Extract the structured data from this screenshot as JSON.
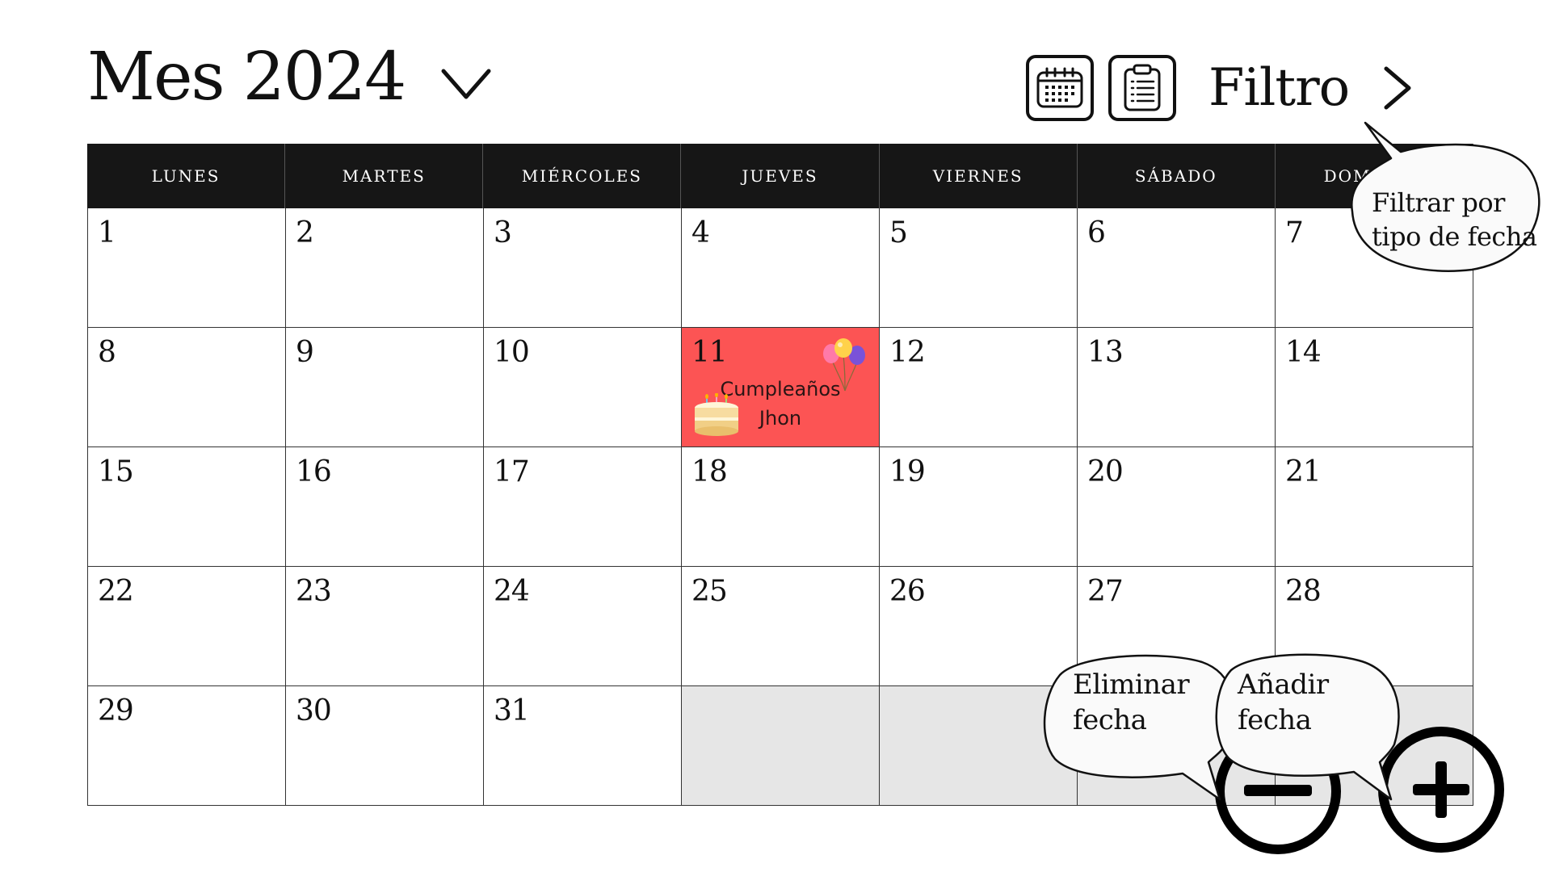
{
  "header": {
    "title": "Mes 2024",
    "dropdown_icon": "chevron-down-icon"
  },
  "toolbar": {
    "calendar_view_icon": "calendar-icon",
    "list_view_icon": "clipboard-list-icon",
    "filter_label": "Filtro",
    "filter_next_icon": "chevron-right-icon"
  },
  "calendar": {
    "weekdays": [
      "LUNES",
      "MARTES",
      "MIÉRCOLES",
      "JUEVES",
      "VIERNES",
      "SÁBADO",
      "DOMINGO"
    ],
    "days": [
      "1",
      "2",
      "3",
      "4",
      "5",
      "6",
      "7",
      "8",
      "9",
      "10",
      "11",
      "12",
      "13",
      "14",
      "15",
      "16",
      "17",
      "18",
      "19",
      "20",
      "21",
      "22",
      "23",
      "24",
      "25",
      "26",
      "27",
      "28",
      "29",
      "30",
      "31"
    ],
    "event": {
      "day": "11",
      "line1": "Cumpleaños",
      "line2": "Jhon",
      "color": "#fc5454",
      "icons": [
        "balloons-icon",
        "cake-icon"
      ]
    },
    "empty_cell_color": "#e6e6e6"
  },
  "tooltips": {
    "filter": {
      "line1": "Filtrar por",
      "line2": "tipo de fecha"
    },
    "delete": {
      "line1": "Eliminar",
      "line2": "fecha"
    },
    "add": {
      "line1": "Añadir",
      "line2": "fecha"
    }
  },
  "actions": {
    "delete_icon": "minus-icon",
    "add_icon": "plus-icon"
  }
}
